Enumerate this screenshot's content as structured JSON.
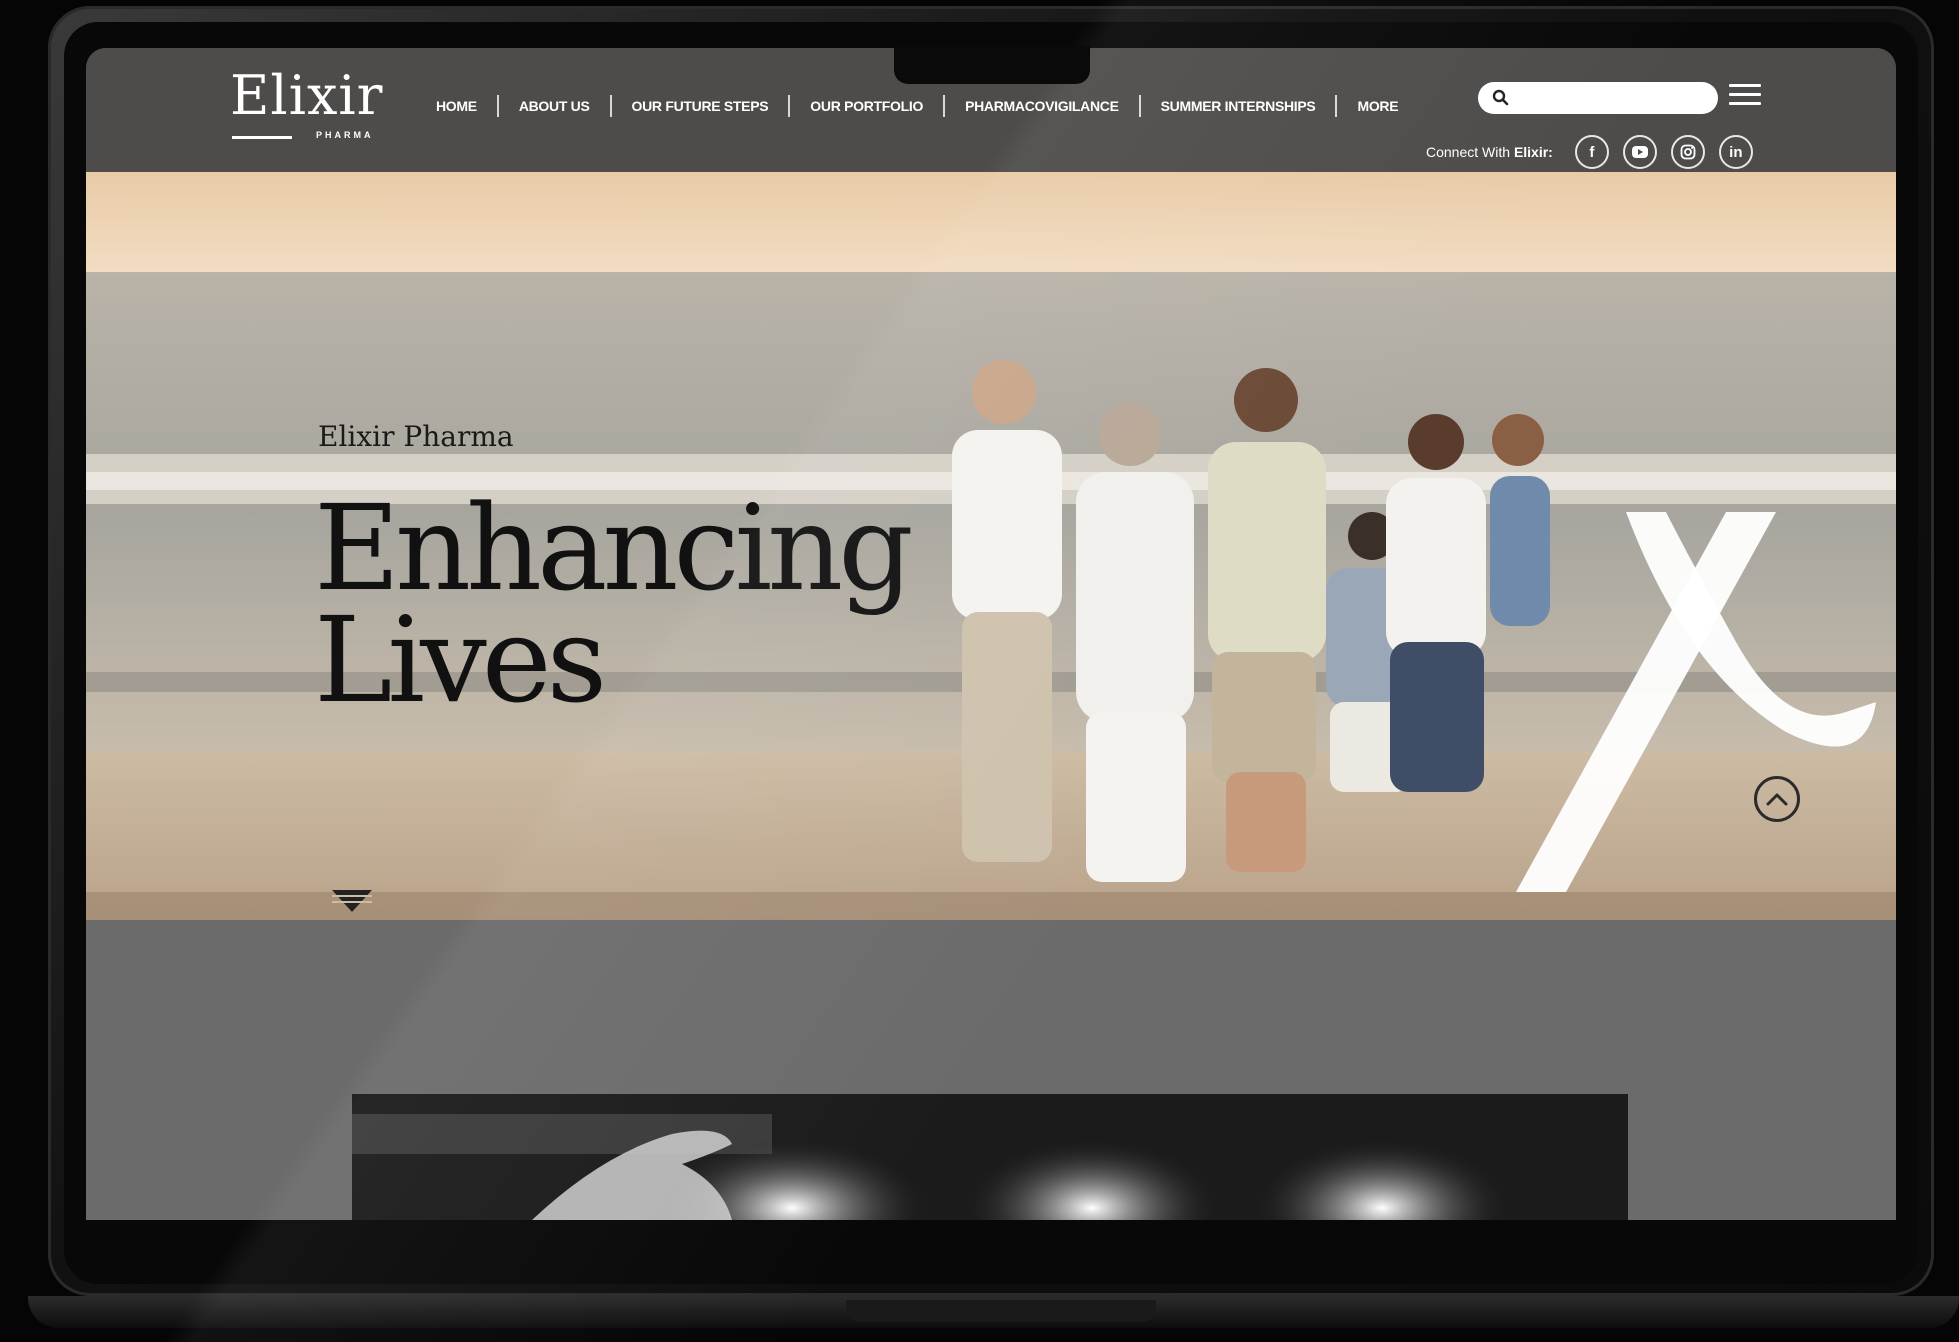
{
  "brand": {
    "logo_text": "Elixir",
    "logo_sub": "PHARMA"
  },
  "nav": {
    "items": [
      {
        "label": "HOME"
      },
      {
        "label": "ABOUT US"
      },
      {
        "label": "OUR FUTURE STEPS"
      },
      {
        "label": "OUR PORTFOLIO"
      },
      {
        "label": "PHARMACOVIGILANCE"
      },
      {
        "label": "SUMMER INTERNSHIPS"
      },
      {
        "label": "MORE"
      }
    ]
  },
  "search": {
    "placeholder": "",
    "icon": "search-icon"
  },
  "connect": {
    "label": "Connect With",
    "brand": "Elixir:",
    "socials": [
      {
        "name": "facebook",
        "glyph": "f"
      },
      {
        "name": "youtube",
        "glyph": "▶"
      },
      {
        "name": "instagram",
        "glyph": "◎"
      },
      {
        "name": "linkedin",
        "glyph": "in"
      }
    ]
  },
  "hero": {
    "kicker": "Elixir Pharma",
    "title_line1": "Enhancing",
    "title_line2": "Lives"
  },
  "colors": {
    "header_bg": "#4e4c4a",
    "band_bg": "#6b6b6b",
    "text_dark": "#111111",
    "white": "#ffffff"
  }
}
